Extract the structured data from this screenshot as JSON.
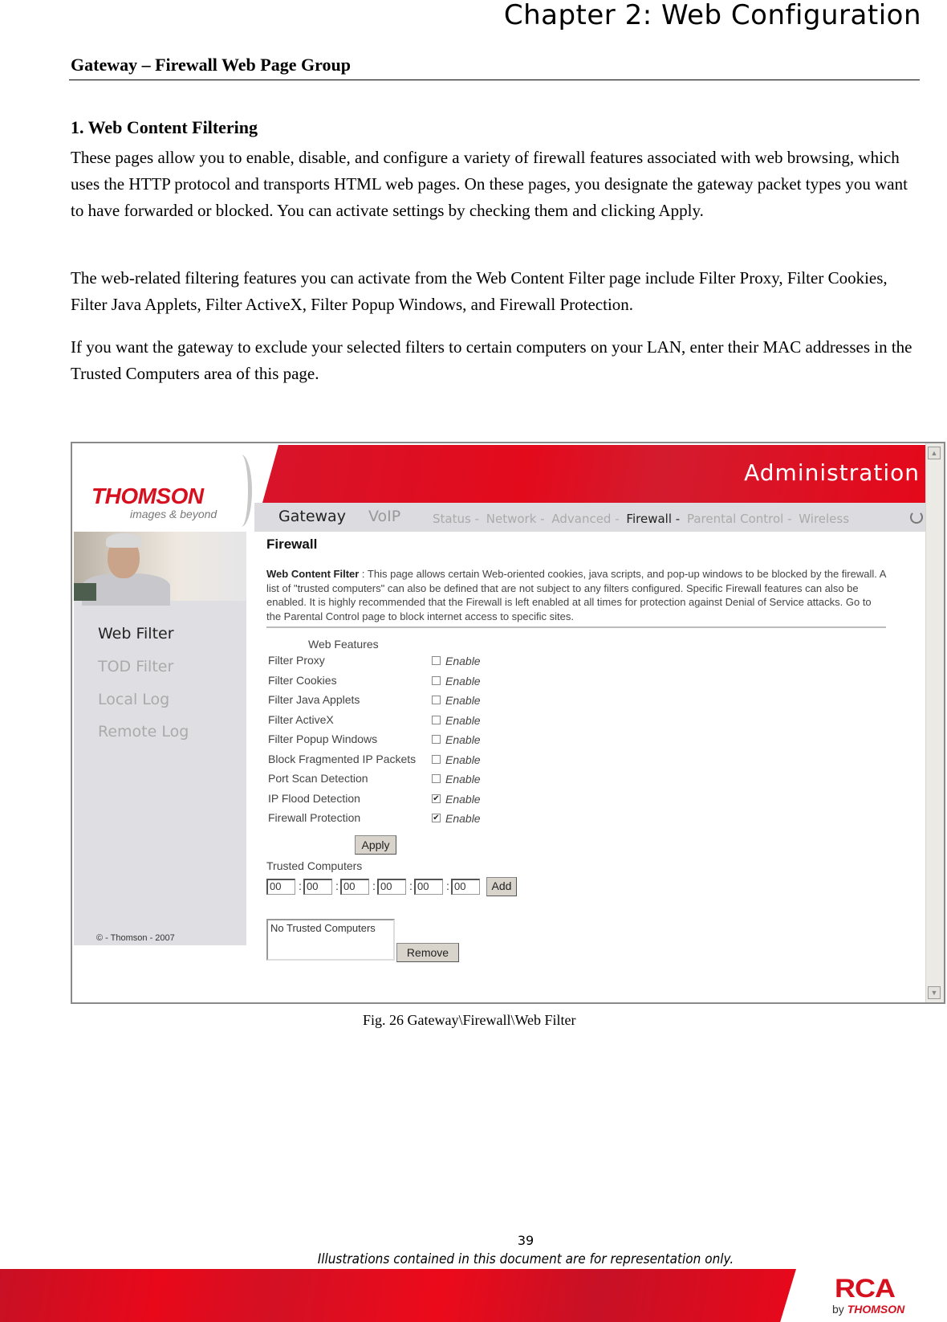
{
  "document": {
    "chapter_title": "Chapter 2: Web Configuration",
    "section_heading": "Gateway – Firewall Web Page Group",
    "sub_heading": "1. Web Content Filtering",
    "paragraphs": [
      "These pages allow you to enable, disable, and configure a variety of firewall features associated with web browsing, which uses the HTTP protocol and transports HTML web pages. On these pages, you designate the gateway packet types you want to have forwarded or blocked. You can activate settings by checking them and clicking Apply.",
      "The web-related filtering features you can activate from the Web Content Filter page include Filter Proxy, Filter Cookies, Filter Java Applets, Filter ActiveX, Filter Popup Windows, and Firewall Protection.",
      "If you want the gateway to exclude your selected filters to certain computers on your LAN, enter their MAC addresses in the Trusted Computers area of this page."
    ],
    "figure_caption": "Fig. 26 Gateway\\Firewall\\Web Filter",
    "page_number": "39",
    "disclaimer": "Illustrations contained in this document are for representation only."
  },
  "brand": {
    "logo_text": "THOMSON",
    "logo_tagline": "images & beyond",
    "footer_logo": "RCA",
    "footer_by": "by",
    "footer_by_brand": "THOMSON",
    "accent_color": "#e30a1c"
  },
  "screenshot": {
    "banner_title": "Administration",
    "main_nav": [
      {
        "label": "Gateway",
        "active": true
      },
      {
        "label": "VoIP",
        "active": false
      }
    ],
    "sub_nav": [
      {
        "label": "Status -",
        "active": false
      },
      {
        "label": "Network -",
        "active": false
      },
      {
        "label": "Advanced -",
        "active": false
      },
      {
        "label": "Firewall -",
        "active": true
      },
      {
        "label": "Parental Control -",
        "active": false
      },
      {
        "label": "Wireless",
        "active": false
      }
    ],
    "sidebar": {
      "items": [
        {
          "label": "Web Filter",
          "active": true
        },
        {
          "label": "TOD Filter",
          "active": false
        },
        {
          "label": "Local Log",
          "active": false
        },
        {
          "label": "Remote Log",
          "active": false
        }
      ],
      "copyright": "© - Thomson - 2007"
    },
    "page_title": "Firewall",
    "description_label": "Web Content Filter",
    "description_sep": " : ",
    "description": "This page allows certain Web-oriented cookies, java scripts, and pop-up windows to be blocked by the firewall. A list of \"trusted computers\" can also be defined that are not subject to any filters configured. Specific Firewall features can also be enabled. It is highly recommended that the Firewall is left enabled at all times for protection against Denial of Service attacks. Go to the Parental Control page to block internet access to specific sites.",
    "web_features_heading": "Web Features",
    "enable_label": "Enable",
    "features": [
      {
        "label": "Filter Proxy",
        "checked": false
      },
      {
        "label": "Filter Cookies",
        "checked": false
      },
      {
        "label": "Filter Java Applets",
        "checked": false
      },
      {
        "label": "Filter ActiveX",
        "checked": false
      },
      {
        "label": "Filter Popup Windows",
        "checked": false
      },
      {
        "label": "Block Fragmented IP Packets",
        "checked": false
      },
      {
        "label": "Port Scan Detection",
        "checked": false
      },
      {
        "label": "IP Flood Detection",
        "checked": true
      },
      {
        "label": "Firewall Protection",
        "checked": true
      }
    ],
    "apply_label": "Apply",
    "trusted_computers_label": "Trusted Computers",
    "mac_fields": [
      "00",
      "00",
      "00",
      "00",
      "00",
      "00"
    ],
    "mac_separator": ":",
    "add_label": "Add",
    "trusted_list_text": "No Trusted Computers",
    "remove_label": "Remove"
  }
}
